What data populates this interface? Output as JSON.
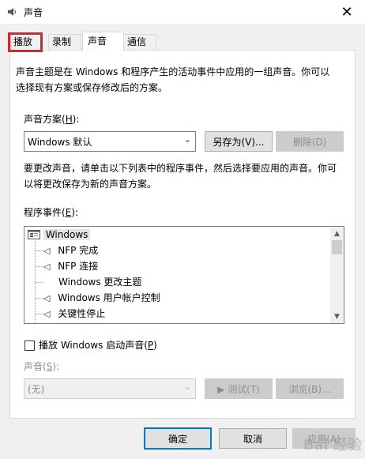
{
  "window": {
    "title": "声音",
    "icon": "speaker-icon",
    "close_glyph": "✕"
  },
  "tabs": [
    {
      "label": "播放",
      "active": false
    },
    {
      "label": "录制",
      "active": false
    },
    {
      "label": "声音",
      "active": true
    },
    {
      "label": "通信",
      "active": false
    }
  ],
  "panel": {
    "intro_line1": "声音主题是在 Windows 和程序产生的活动事件中应用的一组声音。你可以",
    "intro_line2": "选择现有方案或保存修改后的方案。",
    "scheme_label": "声音方案(",
    "scheme_label_key": "H",
    "scheme_label_end": "):",
    "scheme_value": "Windows 默认",
    "save_as_label": "另存为(V)...",
    "delete_label": "删除(D)",
    "hint_line1": "要更改声音，请单击以下列表中的程序事件，然后选择要应用的声音。你可",
    "hint_line2": "以将更改保存为新的声音方案。",
    "events_label": "程序事件(",
    "events_label_key": "E",
    "events_label_end": "):",
    "events": [
      {
        "label": "Windows",
        "type": "root",
        "icon": "windows-group-icon"
      },
      {
        "label": "NFP 完成",
        "type": "sound",
        "icon": "speaker-icon"
      },
      {
        "label": "NFP 连接",
        "type": "sound",
        "icon": "speaker-icon"
      },
      {
        "label": "Windows 更改主题",
        "type": "none",
        "icon": ""
      },
      {
        "label": "Windows 用户帐户控制",
        "type": "sound",
        "icon": "speaker-icon"
      },
      {
        "label": "关键性停止",
        "type": "sound",
        "icon": "speaker-icon"
      }
    ],
    "startup_checkbox_label": "播放 Windows 启动声音(",
    "startup_checkbox_key": "P",
    "startup_checkbox_end": ")",
    "startup_checked": false,
    "sound_label": "声音(",
    "sound_label_key": "S",
    "sound_label_end": "):",
    "sound_value": "(无)",
    "test_label": "▶ 测试(T)",
    "browse_label": "浏览(B)..."
  },
  "footer": {
    "ok_label": "确定",
    "cancel_label": "取消",
    "apply_label": "应用(A)"
  },
  "watermark": "Bai 经验"
}
